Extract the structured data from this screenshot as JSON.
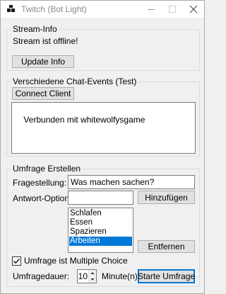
{
  "window": {
    "title": "Twitch (Bot Light)"
  },
  "stream_info": {
    "legend": "Stream-Info",
    "status": "Stream ist offline!",
    "update_button": "Update Info"
  },
  "chat_events": {
    "legend": "Verschiedene Chat-Events (Test)",
    "connect_button": "Connect Client",
    "log_text": "Verbunden mit whitewolfysgame"
  },
  "poll": {
    "legend": "Umfrage Erstellen",
    "question_label": "Fragestellung:",
    "question_value": "Was machen sachen?",
    "answer_label": "Antwort-Option:",
    "answer_value": "",
    "add_button": "Hinzufügen",
    "options": [
      "Schlafen",
      "Essen",
      "Spazieren",
      "Arbeiten"
    ],
    "selected_option": "Arbeiten",
    "remove_button": "Entfernen",
    "multiple_choice_label": "Umfrage ist Multiple Choice",
    "multiple_choice_checked": true,
    "duration_label": "Umfragedauer:",
    "duration_value": "10",
    "duration_unit": "Minute(n)",
    "start_button": "Starte Umfrage"
  },
  "colors": {
    "accent": "#0078d7"
  }
}
